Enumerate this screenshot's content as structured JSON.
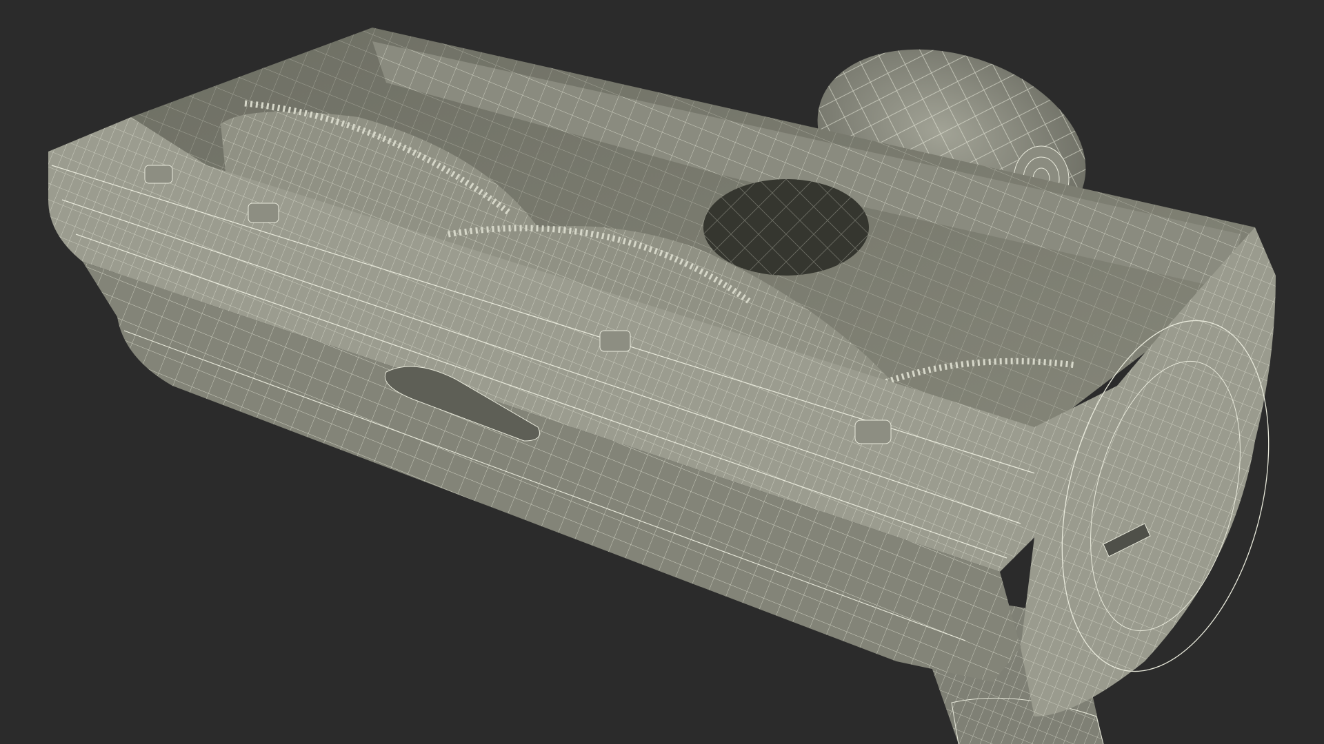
{
  "scene": {
    "subject": "wireframe-render",
    "colors": {
      "background": "#2b2b2b",
      "body": "#8e8f83",
      "body_light": "#a4a598",
      "body_dark": "#6b6c62",
      "interior": "#77786c",
      "wire": "#e9eadc"
    }
  }
}
